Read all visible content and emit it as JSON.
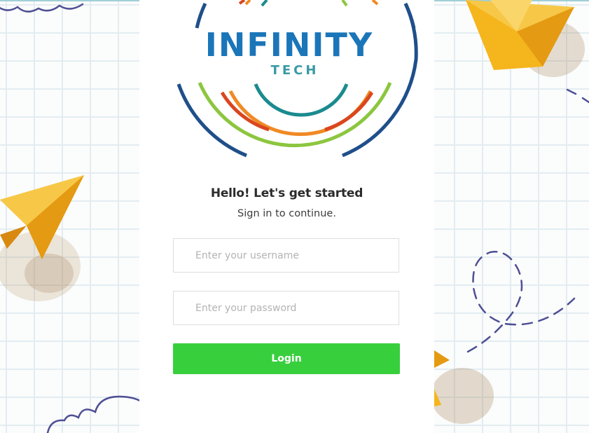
{
  "brand": {
    "logo_main": "INFINITY",
    "logo_sub": "TECH",
    "colors": {
      "logo_blue": "#1b75b9",
      "logo_teal": "#3a9aa5",
      "logo_ring_dark": "#1f4f8a",
      "logo_green": "#8cc63f",
      "logo_orange": "#f08a24",
      "logo_red": "#d9461f",
      "logo_teal_arc": "#1a8b8f"
    }
  },
  "login": {
    "heading": "Hello! Let's get started",
    "subheading": "Sign in to continue.",
    "username_placeholder": "Enter your username",
    "password_placeholder": "Enter your password",
    "login_label": "Login"
  },
  "theme": {
    "button_color": "#38cf3d",
    "paper_plane_color": "#f5b51c",
    "doodle_color": "#4e4f94",
    "grid_color": "#e3edf1"
  }
}
